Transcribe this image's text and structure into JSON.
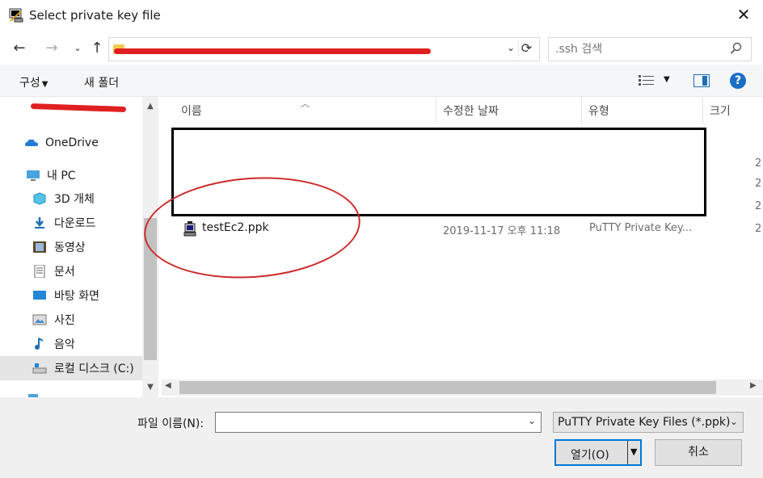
{
  "window": {
    "title": "Select private key file",
    "close_icon": "close-icon"
  },
  "address": {
    "search_placeholder": ".ssh 검색"
  },
  "toolbar": {
    "organize_label": "구성",
    "new_folder_label": "새 폴더"
  },
  "nav": {
    "items": [
      {
        "label": "OneDrive",
        "icon": "onedrive-icon"
      },
      {
        "label": "내 PC",
        "icon": "pc-icon"
      },
      {
        "label": "3D 개체",
        "icon": "3d-objects-icon"
      },
      {
        "label": "다운로드",
        "icon": "download-icon"
      },
      {
        "label": "동영상",
        "icon": "video-icon"
      },
      {
        "label": "문서",
        "icon": "document-icon"
      },
      {
        "label": "바탕 화면",
        "icon": "desktop-icon"
      },
      {
        "label": "사진",
        "icon": "pictures-icon"
      },
      {
        "label": "음악",
        "icon": "music-icon"
      },
      {
        "label": "로컬 디스크 (C:)",
        "icon": "drive-icon"
      }
    ]
  },
  "columns": {
    "name": "이름",
    "modified": "수정한 날짜",
    "type": "유형",
    "size": "크기"
  },
  "files": [
    {
      "name": "testEc2.ppk",
      "modified": "2019-11-17 오후 11:18",
      "type": "PuTTY Private Key..."
    }
  ],
  "size_fragments": [
    "2",
    "2",
    "2",
    "2"
  ],
  "footer": {
    "filename_label": "파일 이름(N):",
    "filename_value": "",
    "filter_value": "PuTTY Private Key Files (*.ppk)",
    "open_label": "열기(O)",
    "cancel_label": "취소"
  },
  "colors": {
    "accent": "#0078d7",
    "annotation_red": "#cc2a2a"
  }
}
